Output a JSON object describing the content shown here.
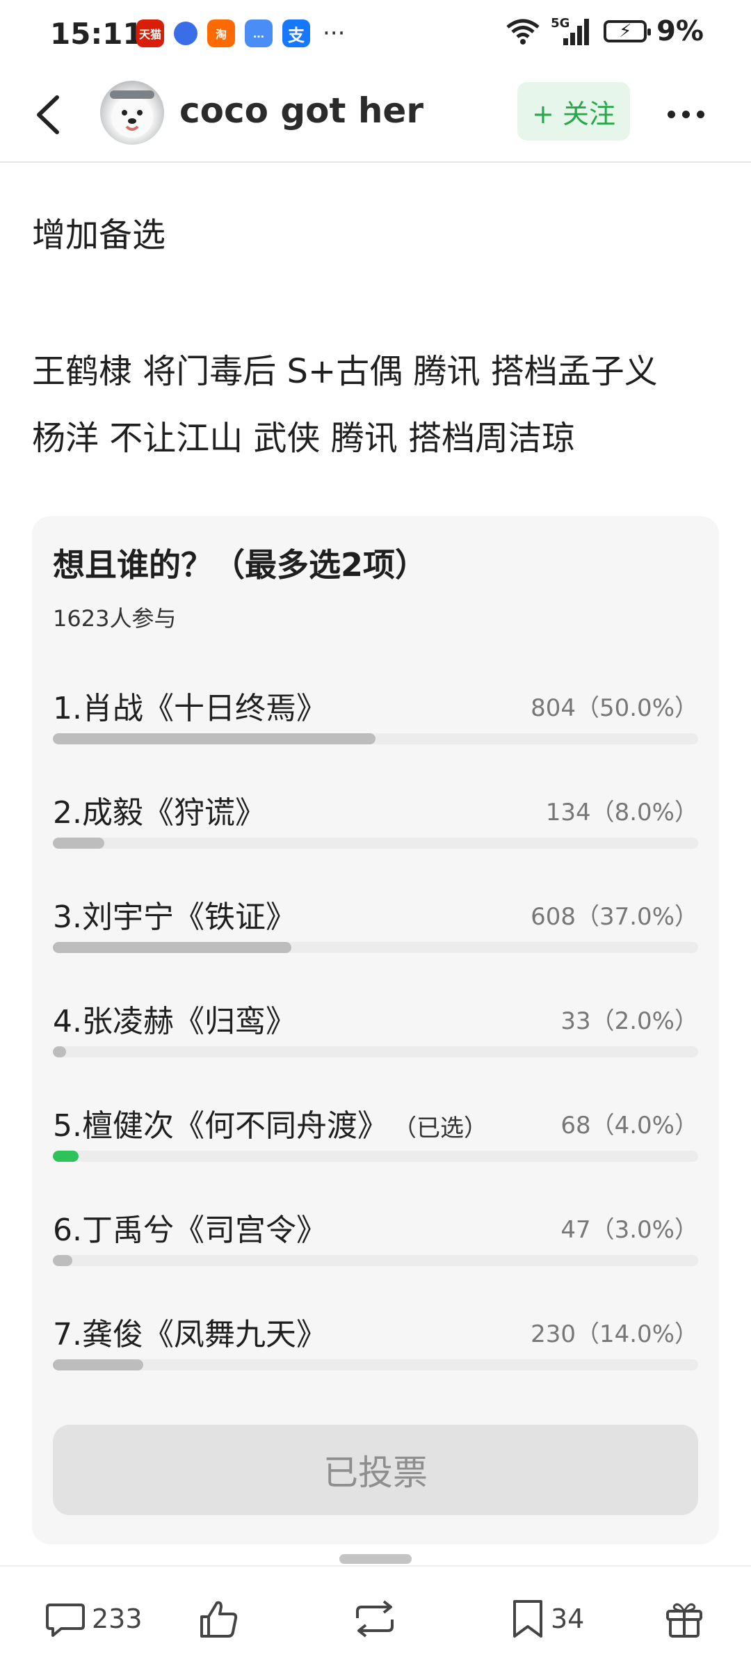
{
  "status_bar": {
    "time": "15:11",
    "notification_icons": [
      {
        "name": "tmall-app-icon",
        "text": "天猫"
      },
      {
        "name": "browser-app-icon",
        "text": ""
      },
      {
        "name": "taobao-app-icon",
        "text": "淘"
      },
      {
        "name": "message-app-icon",
        "text": "…"
      },
      {
        "name": "alipay-app-icon",
        "text": "支"
      }
    ],
    "more": "···",
    "network": "5G",
    "battery": "9%"
  },
  "header": {
    "username": "coco got her",
    "follow_label": "+ 关注"
  },
  "post": {
    "lines": [
      "增加备选",
      "王鹤棣 将门毒后 S+古偶 腾讯 搭档孟子义",
      "杨洋 不让江山 武侠 腾讯 搭档周洁琼"
    ]
  },
  "poll": {
    "title": "想且谁的？（最多选2项）",
    "participants": "1623人参与",
    "options": [
      {
        "label": "1.肖战《十日终焉》",
        "stat": "804（50.0%）",
        "percent": 50.0,
        "selected_text": ""
      },
      {
        "label": "2.成毅《狩谎》",
        "stat": "134（8.0%）",
        "percent": 8.0,
        "selected_text": ""
      },
      {
        "label": "3.刘宇宁《铁证》",
        "stat": "608（37.0%）",
        "percent": 37.0,
        "selected_text": ""
      },
      {
        "label": "4.张凌赫《归鸾》",
        "stat": "33（2.0%）",
        "percent": 2.0,
        "selected_text": ""
      },
      {
        "label": "5.檀健次《何不同舟渡》",
        "stat": "68（4.0%）",
        "percent": 4.0,
        "selected_text": "（已选）"
      },
      {
        "label": "6.丁禹兮《司宫令》",
        "stat": "47（3.0%）",
        "percent": 3.0,
        "selected_text": ""
      },
      {
        "label": "7.龚俊《凤舞九天》",
        "stat": "230（14.0%）",
        "percent": 14.0,
        "selected_text": ""
      }
    ],
    "voted_label": "已投票",
    "selected_color": "#2ec25a",
    "bar_color": "#bdbdbd"
  },
  "bottom_bar": {
    "comments": "233",
    "bookmarks": "34"
  }
}
